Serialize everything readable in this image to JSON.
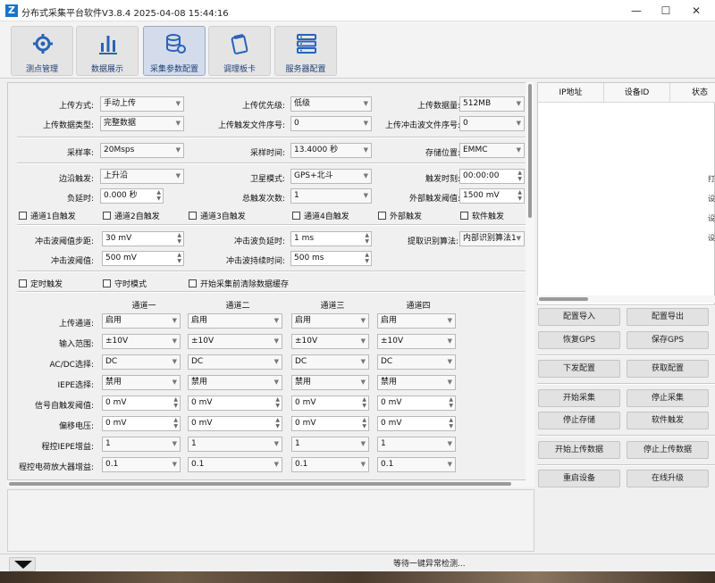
{
  "window": {
    "title": "分布式采集平台软件V3.8.4 2025-04-08 15:44:16",
    "logo": "Z",
    "minimize": "—",
    "maximize": "☐",
    "close": "✕"
  },
  "toolbar": {
    "items": [
      {
        "label": "测点管理",
        "icon": "gear-network-icon"
      },
      {
        "label": "数据展示",
        "icon": "bar-chart-icon"
      },
      {
        "label": "采集参数配置",
        "icon": "database-gear-icon",
        "active": true
      },
      {
        "label": "调理板卡",
        "icon": "card-module-icon"
      },
      {
        "label": "服务器配置",
        "icon": "server-rack-icon"
      }
    ]
  },
  "upload": {
    "mode_label": "上传方式:",
    "mode_value": "手动上传",
    "priority_label": "上传优先级:",
    "priority_value": "低级",
    "amount_label": "上传数据量:",
    "amount_value": "512MB",
    "type_label": "上传数据类型:",
    "type_value": "完整数据",
    "trigger_seq_label": "上传触发文件序号:",
    "trigger_seq_value": "0",
    "shock_seq_label": "上传冲击波文件序号:",
    "shock_seq_value": "0"
  },
  "sampling": {
    "rate_label": "采样率:",
    "rate_value": "20Msps",
    "time_label": "采样时间:",
    "time_value": "13.4000 秒",
    "storage_label": "存储位置:",
    "storage_value": "EMMC"
  },
  "trigger": {
    "edge_label": "边沿触发:",
    "edge_value": "上升沿",
    "sat_label": "卫星模式:",
    "sat_value": "GPS+北斗",
    "trigtime_label": "触发时刻:",
    "trigtime_value": "00:00:00",
    "neg_delay_label": "负延时:",
    "neg_delay_value": "0.000 秒",
    "total_label": "总触发次数:",
    "total_value": "1",
    "ext_thr_label": "外部触发阈值:",
    "ext_thr_value": "1500 mV",
    "checks": [
      "通道1自触发",
      "通道2自触发",
      "通道3自触发",
      "通道4自触发",
      "外部触发",
      "软件触发"
    ]
  },
  "shock": {
    "step_label": "冲击波阈值步距:",
    "step_value": "30 mV",
    "neg_delay_label": "冲击波负延时:",
    "neg_delay_value": "1 ms",
    "algo_label": "提取识别算法:",
    "algo_value": "内部识别算法1",
    "thr_label": "冲击波阈值:",
    "thr_value": "500 mV",
    "dur_label": "冲击波持续时间:",
    "dur_value": "500 ms"
  },
  "modes": {
    "timed": "定时触发",
    "guard": "守时模式",
    "clear": "开始采集前清除数据缓存"
  },
  "channels": {
    "headers": [
      "通道一",
      "通道二",
      "通道三",
      "通道四"
    ],
    "rows": [
      {
        "label": "上传通道:",
        "values": [
          "启用",
          "启用",
          "启用",
          "启用"
        ],
        "kind": "combo"
      },
      {
        "label": "输入范围:",
        "values": [
          "±10V",
          "±10V",
          "±10V",
          "±10V"
        ],
        "kind": "combo"
      },
      {
        "label": "AC/DC选择:",
        "values": [
          "DC",
          "DC",
          "DC",
          "DC"
        ],
        "kind": "combo"
      },
      {
        "label": "IEPE选择:",
        "values": [
          "禁用",
          "禁用",
          "禁用",
          "禁用"
        ],
        "kind": "combo"
      },
      {
        "label": "信号自触发阈值:",
        "values": [
          "0 mV",
          "0 mV",
          "0 mV",
          "0 mV"
        ],
        "kind": "spin"
      },
      {
        "label": "偏移电压:",
        "values": [
          "0 mV",
          "0 mV",
          "0 mV",
          "0 mV"
        ],
        "kind": "spin"
      },
      {
        "label": "程控IEPE增益:",
        "values": [
          "1",
          "1",
          "1",
          "1"
        ],
        "kind": "combo"
      },
      {
        "label": "程控电荷放大器增益:",
        "values": [
          "0.1",
          "0.1",
          "0.1",
          "0.1"
        ],
        "kind": "combo"
      }
    ]
  },
  "device_table": {
    "columns": [
      "IP地址",
      "设备ID",
      "状态"
    ]
  },
  "actions": {
    "import_cfg": "配置导入",
    "export_cfg": "配置导出",
    "restore_gps": "恢复GPS",
    "save_gps": "保存GPS",
    "send_cfg": "下发配置",
    "get_cfg": "获取配置",
    "start_acq": "开始采集",
    "stop_acq": "停止采集",
    "stop_store": "停止存储",
    "soft_trig": "软件触发",
    "start_upload": "开始上传数据",
    "stop_upload": "停止上传数据",
    "restart": "重启设备",
    "upgrade": "在线升级"
  },
  "status": {
    "message": "等待一键异常检测..."
  },
  "right_peek": [
    "打",
    "设",
    "设",
    "设"
  ]
}
